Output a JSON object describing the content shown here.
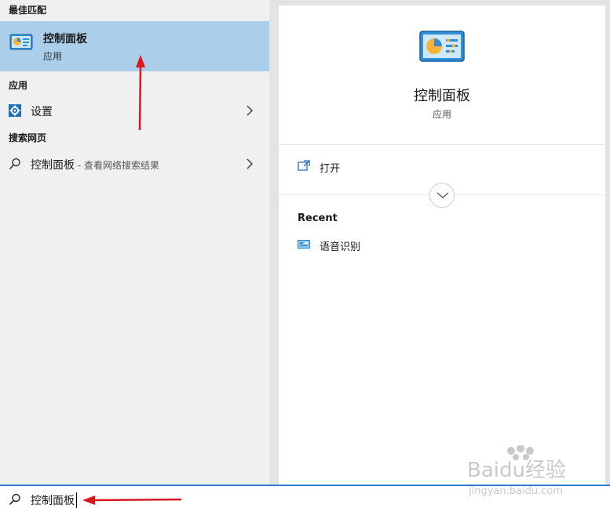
{
  "left": {
    "best_match_header": "最佳匹配",
    "best_match": {
      "title": "控制面板",
      "subtitle": "应用"
    },
    "apps_header": "应用",
    "settings_label": "设置",
    "web_header": "搜索网页",
    "web_result": {
      "label": "控制面板",
      "hint": " - 查看网络搜索结果"
    }
  },
  "right": {
    "title": "控制面板",
    "subtitle": "应用",
    "open_label": "打开",
    "recent_title": "Recent",
    "recent_items": [
      "语音识别"
    ]
  },
  "search": {
    "value": "控制面板"
  },
  "watermark": {
    "brand": "Baidu经验",
    "site": "jingyan.baidu.com"
  },
  "colors": {
    "selection": "#abcfeb",
    "search_border": "#2d7bd2",
    "annotation_arrow": "#d9181f"
  }
}
